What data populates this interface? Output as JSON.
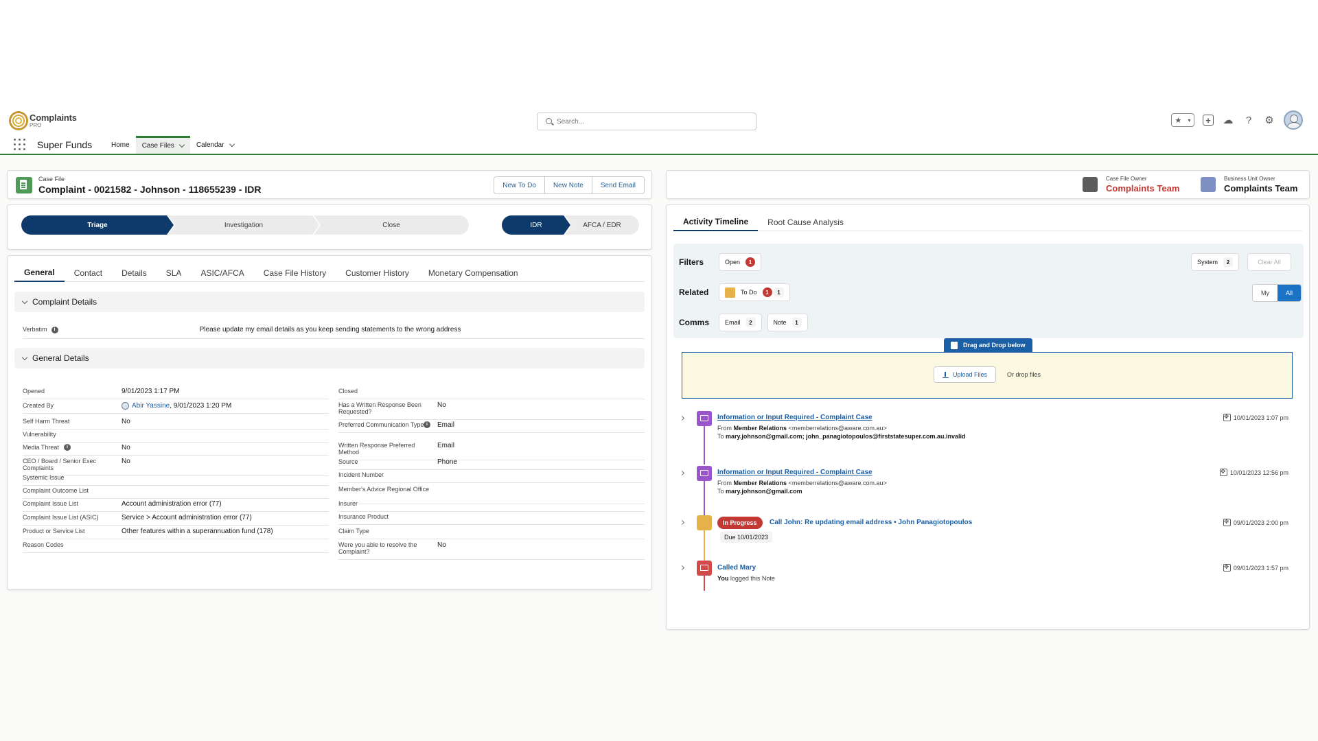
{
  "brand": {
    "name": "Complaints",
    "sub": "PRO"
  },
  "search": {
    "placeholder": "Search..."
  },
  "app": {
    "name": "Super Funds"
  },
  "nav": {
    "home": "Home",
    "case_files": "Case Files",
    "calendar": "Calendar"
  },
  "record": {
    "type_label": "Case File",
    "title": "Complaint - 0021582 - Johnson - 118655239 - IDR",
    "actions": {
      "new_todo": "New To Do",
      "new_note": "New Note",
      "send_email": "Send Email"
    }
  },
  "path": {
    "steps": [
      "Triage",
      "Investigation",
      "Close"
    ],
    "stages": [
      "IDR",
      "AFCA / EDR"
    ]
  },
  "detail_tabs": [
    "General",
    "Contact",
    "Details",
    "SLA",
    "ASIC/AFCA",
    "Case File History",
    "Customer History",
    "Monetary Compensation"
  ],
  "complaint_details": {
    "heading": "Complaint Details",
    "verbatim_label": "Verbatim",
    "verbatim_value": "Please update my email details as you keep sending statements to the wrong address"
  },
  "general_details": {
    "heading": "General Details",
    "left": [
      {
        "label": "Opened",
        "value": "9/01/2023 1:17 PM"
      },
      {
        "label": "Created By",
        "user": "Abir Yassine",
        "value": ", 9/01/2023 1:20 PM"
      },
      {
        "label": "Self Harm Threat",
        "value": "No"
      },
      {
        "label": "Vulnerability",
        "value": ""
      },
      {
        "label": "Media Threat",
        "value": "No"
      },
      {
        "label": "CEO / Board / Senior Exec Complaints",
        "value": "No"
      },
      {
        "label": "Systemic Issue",
        "value": ""
      },
      {
        "label": "Complaint Outcome List",
        "value": ""
      },
      {
        "label": "Complaint Issue List",
        "value": "Account administration error (77)"
      },
      {
        "label": "Complaint Issue List (ASIC)",
        "value": "Service > Account administration error (77)"
      },
      {
        "label": "Product or Service List",
        "value": "Other features within a superannuation fund (178)"
      },
      {
        "label": "Reason Codes",
        "value": ""
      }
    ],
    "right": [
      {
        "label": "Closed",
        "value": ""
      },
      {
        "label": "Has a Written Response Been Requested?",
        "value": "No"
      },
      {
        "label": "Preferred Communication Type",
        "value": "Email"
      },
      {
        "label": "Written Response Preferred Method",
        "value": "Email"
      },
      {
        "label": "Source",
        "value": "Phone"
      },
      {
        "label": "Incident Number",
        "value": ""
      },
      {
        "label": "Member's Advice Regional Office",
        "value": ""
      },
      {
        "label": "Insurer",
        "value": ""
      },
      {
        "label": "Insurance Product",
        "value": ""
      },
      {
        "label": "Claim Type",
        "value": ""
      },
      {
        "label": "Were you able to resolve the Complaint?",
        "value": "No"
      }
    ]
  },
  "owners": {
    "case_owner_label": "Case File Owner",
    "case_owner_value": "Complaints Team",
    "bu_owner_label": "Business Unit Owner",
    "bu_owner_value": "Complaints Team"
  },
  "activity": {
    "tabs": [
      "Activity Timeline",
      "Root Cause Analysis"
    ],
    "filters_label": "Filters",
    "open_label": "Open",
    "open_count": "1",
    "system_label": "System",
    "system_count": "2",
    "clear_all": "Clear All",
    "related_label": "Related",
    "todo_label": "To Do",
    "todo_red": "1",
    "todo_count": "1",
    "my": "My",
    "all": "All",
    "comms_label": "Comms",
    "email_label": "Email",
    "email_count": "2",
    "note_label": "Note",
    "note_count": "1",
    "drag_drop": "Drag and Drop below",
    "upload": "Upload Files",
    "or_drop": "Or drop files"
  },
  "timeline": [
    {
      "title": "Information or Input Required - Complaint Case",
      "from_label": "From",
      "from_name": "Member Relations",
      "from_email": "<memberrelations@aware.com.au>",
      "to_label": "To",
      "to": "mary.johnson@gmail.com; john_panagiotopoulos@firststatesuper.com.au.invalid",
      "date": "10/01/2023 1:07 pm"
    },
    {
      "title": "Information or Input Required - Complaint Case",
      "from_label": "From",
      "from_name": "Member Relations",
      "from_email": "<memberrelations@aware.com.au>",
      "to_label": "To",
      "to": "mary.johnson@gmail.com",
      "date": "10/01/2023 12:56 pm"
    },
    {
      "status": "In Progress",
      "title": "Call John: Re updating email address • John Panagiotopoulos",
      "due": "Due 10/01/2023",
      "date": "09/01/2023 2:00 pm"
    },
    {
      "title": "Called Mary",
      "who": "You",
      "action": "logged this Note",
      "date": "09/01/2023 1:57 pm"
    }
  ],
  "colors": {
    "brand_green": "#2e7d32",
    "path_navy": "#0d3a6a",
    "alert_red": "#c23934",
    "link_blue": "#1b5fa6"
  }
}
